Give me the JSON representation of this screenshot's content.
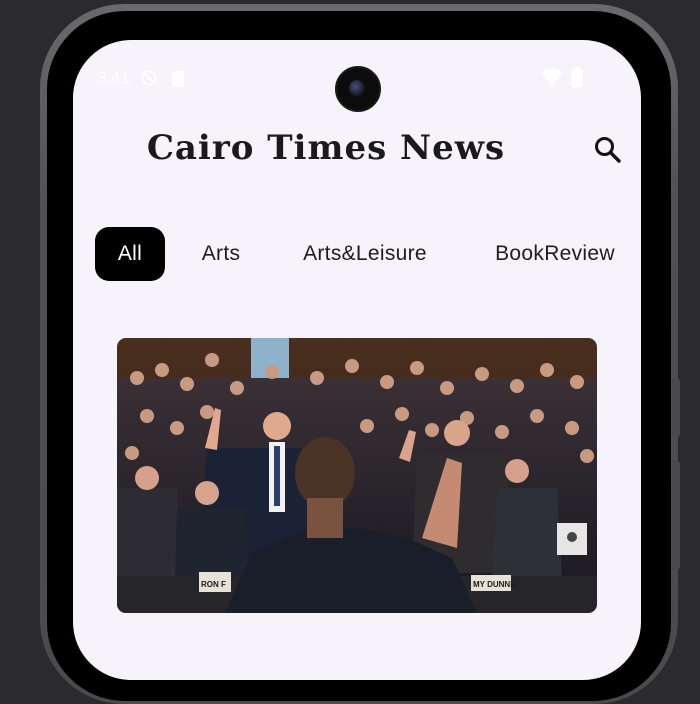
{
  "status_bar": {
    "time": "3:41"
  },
  "header": {
    "title": "Cairo Times News"
  },
  "tabs": [
    {
      "label": "All",
      "active": true
    },
    {
      "label": "Arts",
      "active": false
    },
    {
      "label": "Arts&Leisure",
      "active": false
    },
    {
      "label": "BookReview",
      "active": false
    }
  ],
  "article": {
    "placard_left": "RON F",
    "placard_right": "MY DUNNE"
  },
  "colors": {
    "screen_bg": "#f6f3fb",
    "tab_active_bg": "#000000",
    "tab_active_text": "#ffffff",
    "title_text": "#1a1a1a"
  },
  "icons": {
    "search": "search-icon",
    "wifi": "wifi-icon",
    "battery": "battery-icon",
    "dnd": "do-not-disturb-icon",
    "sim": "sim-card-icon"
  }
}
